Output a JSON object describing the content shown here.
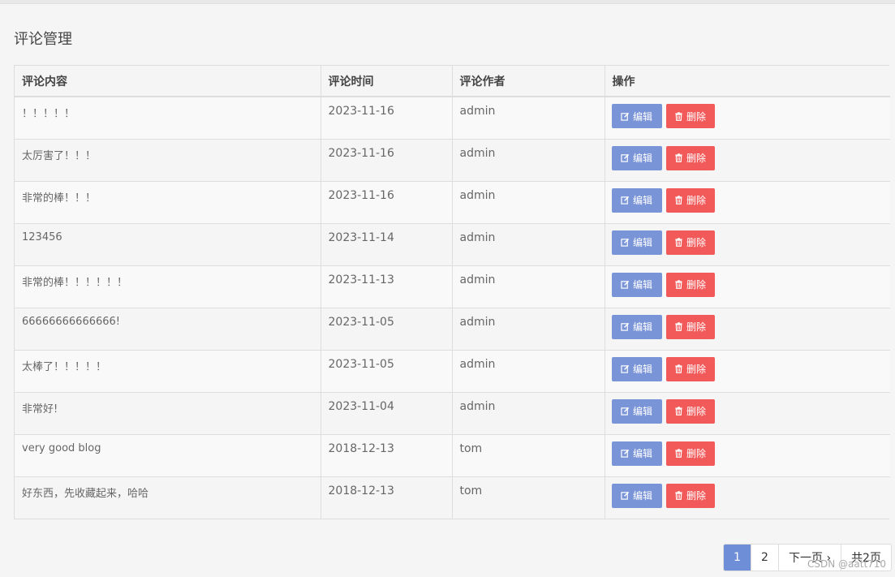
{
  "page": {
    "title": "评论管理"
  },
  "table": {
    "headers": [
      "评论内容",
      "评论时间",
      "评论作者",
      "操作"
    ],
    "rows": [
      {
        "content": "！！！！！",
        "time": "2023-11-16",
        "author": "admin"
      },
      {
        "content": "太厉害了！！！",
        "time": "2023-11-16",
        "author": "admin"
      },
      {
        "content": "非常的棒！！！",
        "time": "2023-11-16",
        "author": "admin"
      },
      {
        "content": "123456",
        "time": "2023-11-14",
        "author": "admin"
      },
      {
        "content": "非常的棒！！！！！！",
        "time": "2023-11-13",
        "author": "admin"
      },
      {
        "content": "66666666666666!",
        "time": "2023-11-05",
        "author": "admin"
      },
      {
        "content": "太棒了！！！！！",
        "time": "2023-11-05",
        "author": "admin"
      },
      {
        "content": "非常好!",
        "time": "2023-11-04",
        "author": "admin"
      },
      {
        "content": "very good blog",
        "time": "2018-12-13",
        "author": "tom"
      },
      {
        "content": "好东西，先收藏起来，哈哈",
        "time": "2018-12-13",
        "author": "tom"
      }
    ],
    "edit_label": "编辑",
    "delete_label": "删除"
  },
  "pagination": {
    "current": "1",
    "page2": "2",
    "next_label": "下一页 ›",
    "total_label": "共2页"
  },
  "watermark": "CSDN @aatt710",
  "colors": {
    "edit_button": "#7a94d8",
    "delete_button": "#f25a5a",
    "active_page": "#6e8ed8"
  },
  "icons": {
    "edit": "edit-square-icon",
    "delete": "trash-icon"
  }
}
